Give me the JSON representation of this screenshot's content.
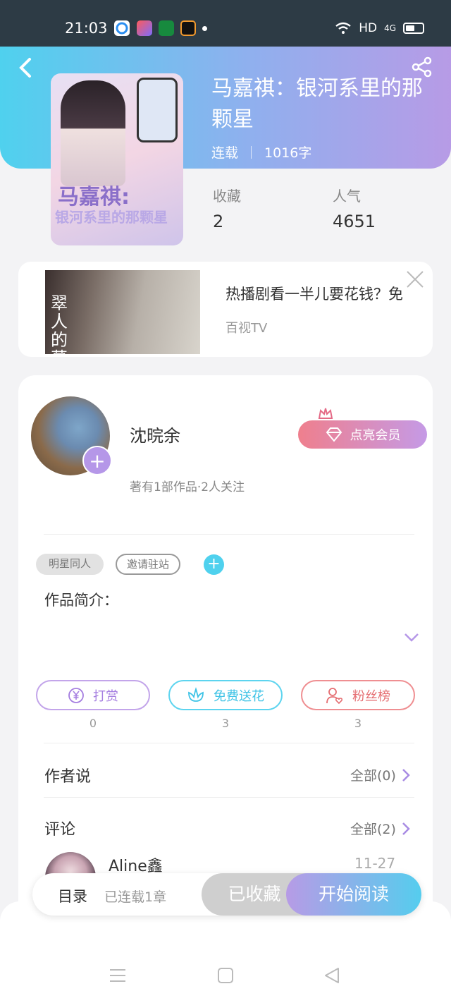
{
  "status_bar": {
    "time": "21:03",
    "network": "HD",
    "signal": "4G",
    "icons": [
      "browser-icon",
      "app-icon",
      "oppo-icon",
      "app-icon-2",
      "wifi-icon",
      "signal-icon",
      "battery-icon"
    ]
  },
  "header": {
    "back_icon": "back-arrow-icon",
    "share_icon": "share-icon",
    "title": "马嘉祺：银河系里的那颗星",
    "status": "连载",
    "word_count": "1016字",
    "favorites_label": "收藏",
    "favorites_value": "2",
    "popularity_label": "人气",
    "popularity_value": "4651",
    "cover_text_1": "马嘉祺:",
    "cover_text_2": "银河系里的那颗星"
  },
  "ad": {
    "thumb_text": "翠人的幕",
    "headline": "热播剧看一半儿要花钱？免",
    "source": "百视TV",
    "close_icon": "close-icon"
  },
  "author": {
    "name": "沈晥余",
    "sub": "著有1部作品·2人关注",
    "follow_icon": "plus-icon",
    "vip_label": "点亮会员",
    "vip_icon": "diamond-icon",
    "crown_icon": "crown-icon"
  },
  "tags": {
    "items": [
      "明星同人",
      "邀请驻站"
    ],
    "add_icon": "plus-icon"
  },
  "intro": {
    "label": "作品简介：",
    "expand_icon": "chevron-down-icon"
  },
  "actions": {
    "reward": {
      "label": "打赏",
      "count": "0",
      "icon": "yen-icon"
    },
    "flower": {
      "label": "免费送花",
      "count": "3",
      "icon": "flower-icon"
    },
    "fans": {
      "label": "粉丝榜",
      "count": "3",
      "icon": "user-heart-icon"
    }
  },
  "author_says": {
    "label": "作者说",
    "more": "全部(0)"
  },
  "comments": {
    "label": "评论",
    "more": "全部(2)",
    "first": {
      "name": "Aline鑫",
      "date": "11-27"
    }
  },
  "bottom_bar": {
    "toc": "目录",
    "toc_sub": "已连载1章",
    "saved": "已收藏",
    "read": "开始阅读"
  },
  "nav": {
    "icons": [
      "menu-icon",
      "home-icon",
      "back-icon"
    ]
  },
  "colors": {
    "accent_purple": "#b79be6",
    "accent_cyan": "#4fd1ee",
    "accent_red": "#ef8f92"
  }
}
